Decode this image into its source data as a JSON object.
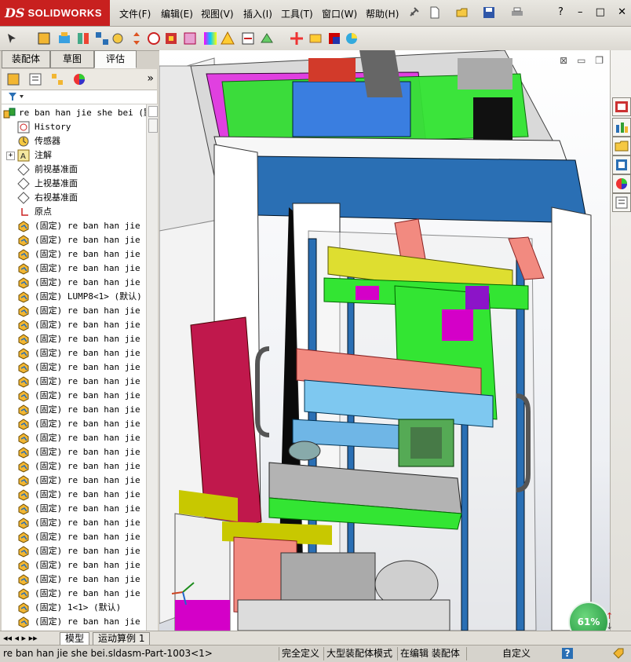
{
  "app": {
    "logo_ds": "DS",
    "logo_name": "SOLIDWORKS",
    "menus": [
      "文件(F)",
      "编辑(E)",
      "视图(V)",
      "插入(I)",
      "工具(T)",
      "窗口(W)",
      "帮助(H)"
    ],
    "window_controls": [
      "?",
      "–",
      "□",
      "✕"
    ]
  },
  "left_panel": {
    "tabs": [
      "装配体",
      "草图",
      "评估"
    ],
    "active_tab": 2,
    "filter_icon": "filter-icon",
    "more_arrow": "»",
    "tree": [
      {
        "label": "re ban han jie she bei  (默",
        "icon": "assembly-icon",
        "expander": ""
      },
      {
        "label": "History",
        "icon": "history-icon",
        "expander": ""
      },
      {
        "label": "传感器",
        "icon": "sensor-icon",
        "expander": ""
      },
      {
        "label": "注解",
        "icon": "annotation-icon",
        "expander": "+"
      },
      {
        "label": "前视基准面",
        "icon": "plane-icon",
        "expander": ""
      },
      {
        "label": "上视基准面",
        "icon": "plane-icon",
        "expander": ""
      },
      {
        "label": "右视基准面",
        "icon": "plane-icon",
        "expander": ""
      },
      {
        "label": "原点",
        "icon": "origin-icon",
        "expander": ""
      },
      {
        "label": "(固定) re ban han jie sh",
        "icon": "part-icon",
        "expander": ""
      },
      {
        "label": "(固定) re ban han jie sh",
        "icon": "part-icon",
        "expander": ""
      },
      {
        "label": "(固定) re ban han jie sh",
        "icon": "part-icon",
        "expander": ""
      },
      {
        "label": "(固定) re ban han jie sh",
        "icon": "part-icon",
        "expander": ""
      },
      {
        "label": "(固定) re ban han jie sh",
        "icon": "part-icon",
        "expander": ""
      },
      {
        "label": "(固定) LUMP8<1> (默认)",
        "icon": "part-icon",
        "expander": ""
      },
      {
        "label": "(固定) re ban han jie sh",
        "icon": "part-icon",
        "expander": ""
      },
      {
        "label": "(固定) re ban han jie sh",
        "icon": "part-icon",
        "expander": ""
      },
      {
        "label": "(固定) re ban han jie sh",
        "icon": "part-icon",
        "expander": ""
      },
      {
        "label": "(固定) re ban han jie sh",
        "icon": "part-icon",
        "expander": ""
      },
      {
        "label": "(固定) re ban han jie sh",
        "icon": "part-icon",
        "expander": ""
      },
      {
        "label": "(固定) re ban han jie sh",
        "icon": "part-icon",
        "expander": ""
      },
      {
        "label": "(固定) re ban han jie sh",
        "icon": "part-icon",
        "expander": ""
      },
      {
        "label": "(固定) re ban han jie sh",
        "icon": "part-icon",
        "expander": ""
      },
      {
        "label": "(固定) re ban han jie sh",
        "icon": "part-icon",
        "expander": ""
      },
      {
        "label": "(固定) re ban han jie sh",
        "icon": "part-icon",
        "expander": ""
      },
      {
        "label": "(固定) re ban han jie sh",
        "icon": "part-icon",
        "expander": ""
      },
      {
        "label": "(固定) re ban han jie sh",
        "icon": "part-icon",
        "expander": ""
      },
      {
        "label": "(固定) re ban han jie sh",
        "icon": "part-icon",
        "expander": ""
      },
      {
        "label": "(固定) re ban han jie sh",
        "icon": "part-icon",
        "expander": ""
      },
      {
        "label": "(固定) re ban han jie sh",
        "icon": "part-icon",
        "expander": ""
      },
      {
        "label": "(固定) re ban han jie sh",
        "icon": "part-icon",
        "expander": ""
      },
      {
        "label": "(固定) re ban han jie sh",
        "icon": "part-icon",
        "expander": ""
      },
      {
        "label": "(固定) re ban han jie sh",
        "icon": "part-icon",
        "expander": ""
      },
      {
        "label": "(固定) re ban han jie sh",
        "icon": "part-icon",
        "expander": ""
      },
      {
        "label": "(固定) re ban han jie sh",
        "icon": "part-icon",
        "expander": ""
      },
      {
        "label": "(固定) re ban han jie sh",
        "icon": "part-icon",
        "expander": ""
      },
      {
        "label": "(固定) 1<1> (默认)",
        "icon": "part-icon",
        "expander": ""
      },
      {
        "label": "(固定) re ban han jie sh",
        "icon": "part-icon",
        "expander": ""
      }
    ]
  },
  "bottom_tabs": [
    "模型",
    "运动算例 1"
  ],
  "status": {
    "path": "re ban han jie she bei.sldasm-Part-1003<1>",
    "fully_defined": "完全定义",
    "large_assembly": "大型装配体模式",
    "editing": "在编辑 装配体",
    "custom": "自定义",
    "help": "?"
  },
  "perf_bubble": {
    "value": "61%"
  },
  "colors": {
    "accent_red": "#c8201f",
    "model_green": "#22dd22",
    "model_blue": "#2a6fb4",
    "model_magenta": "#d400c8",
    "model_salmon": "#f28a80"
  }
}
